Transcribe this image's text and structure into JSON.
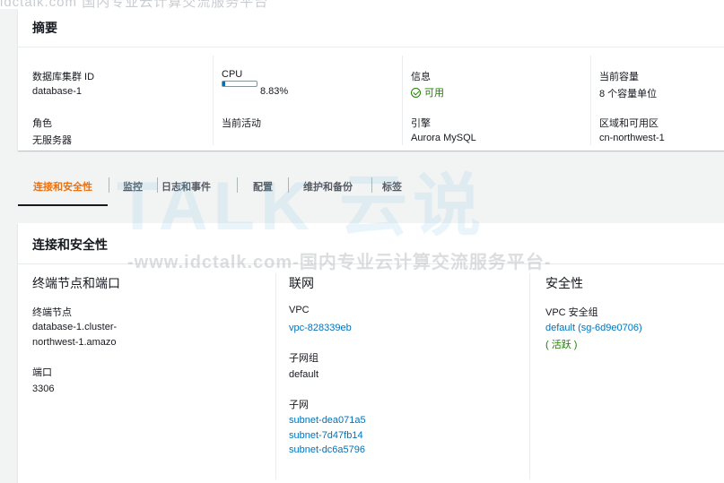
{
  "banner": {
    "text": "idctalk.com 国内专业云计算交流服务平台"
  },
  "summary": {
    "title": "摘要",
    "cluster_id_label": "数据库集群 ID",
    "cluster_id_value": "database-1",
    "role_label": "角色",
    "role_value": "无服务器",
    "cpu_label": "CPU",
    "cpu_value": "8.83%",
    "cpu_fraction": 0.0883,
    "activity_label": "当前活动",
    "info_label": "信息",
    "info_value": "可用",
    "engine_label": "引擎",
    "engine_value": "Aurora MySQL",
    "capacity_label": "当前容量",
    "capacity_value": "8 个容量单位",
    "region_label": "区域和可用区",
    "region_value": "cn-northwest-1",
    "status_color": "#1d8102",
    "accent_color": "#ec7211",
    "link_color": "#0073bb"
  },
  "tabs": [
    {
      "label": "连接和安全性",
      "active": true
    },
    {
      "label": "监控"
    },
    {
      "label": "日志和事件"
    },
    {
      "label": "配置"
    },
    {
      "label": "维护和备份"
    },
    {
      "label": "标签"
    }
  ],
  "conn": {
    "title": "连接和安全性",
    "endpoints": {
      "heading": "终端节点和端口",
      "endpoint_label": "终端节点",
      "endpoint_line1": "database-1.cluster-",
      "endpoint_line2": "northwest-1.amazo",
      "port_label": "端口",
      "port_value": "3306"
    },
    "network": {
      "heading": "联网",
      "vpc_label": "VPC",
      "vpc_value": "vpc-828339eb",
      "subnet_group_label": "子网组",
      "subnet_group_value": "default",
      "subnets_label": "子网",
      "subnets": [
        "subnet-dea071a5",
        "subnet-7d47fb14",
        "subnet-dc6a5796"
      ]
    },
    "security": {
      "heading": "安全性",
      "sg_label": "VPC 安全组",
      "sg_value": "default (sg-6d9e0706)",
      "sg_status": "( 活跃 )"
    }
  },
  "watermark": {
    "big": "TALK 云说",
    "line": "-www.idctalk.com-国内专业云计算交流服务平台-"
  }
}
